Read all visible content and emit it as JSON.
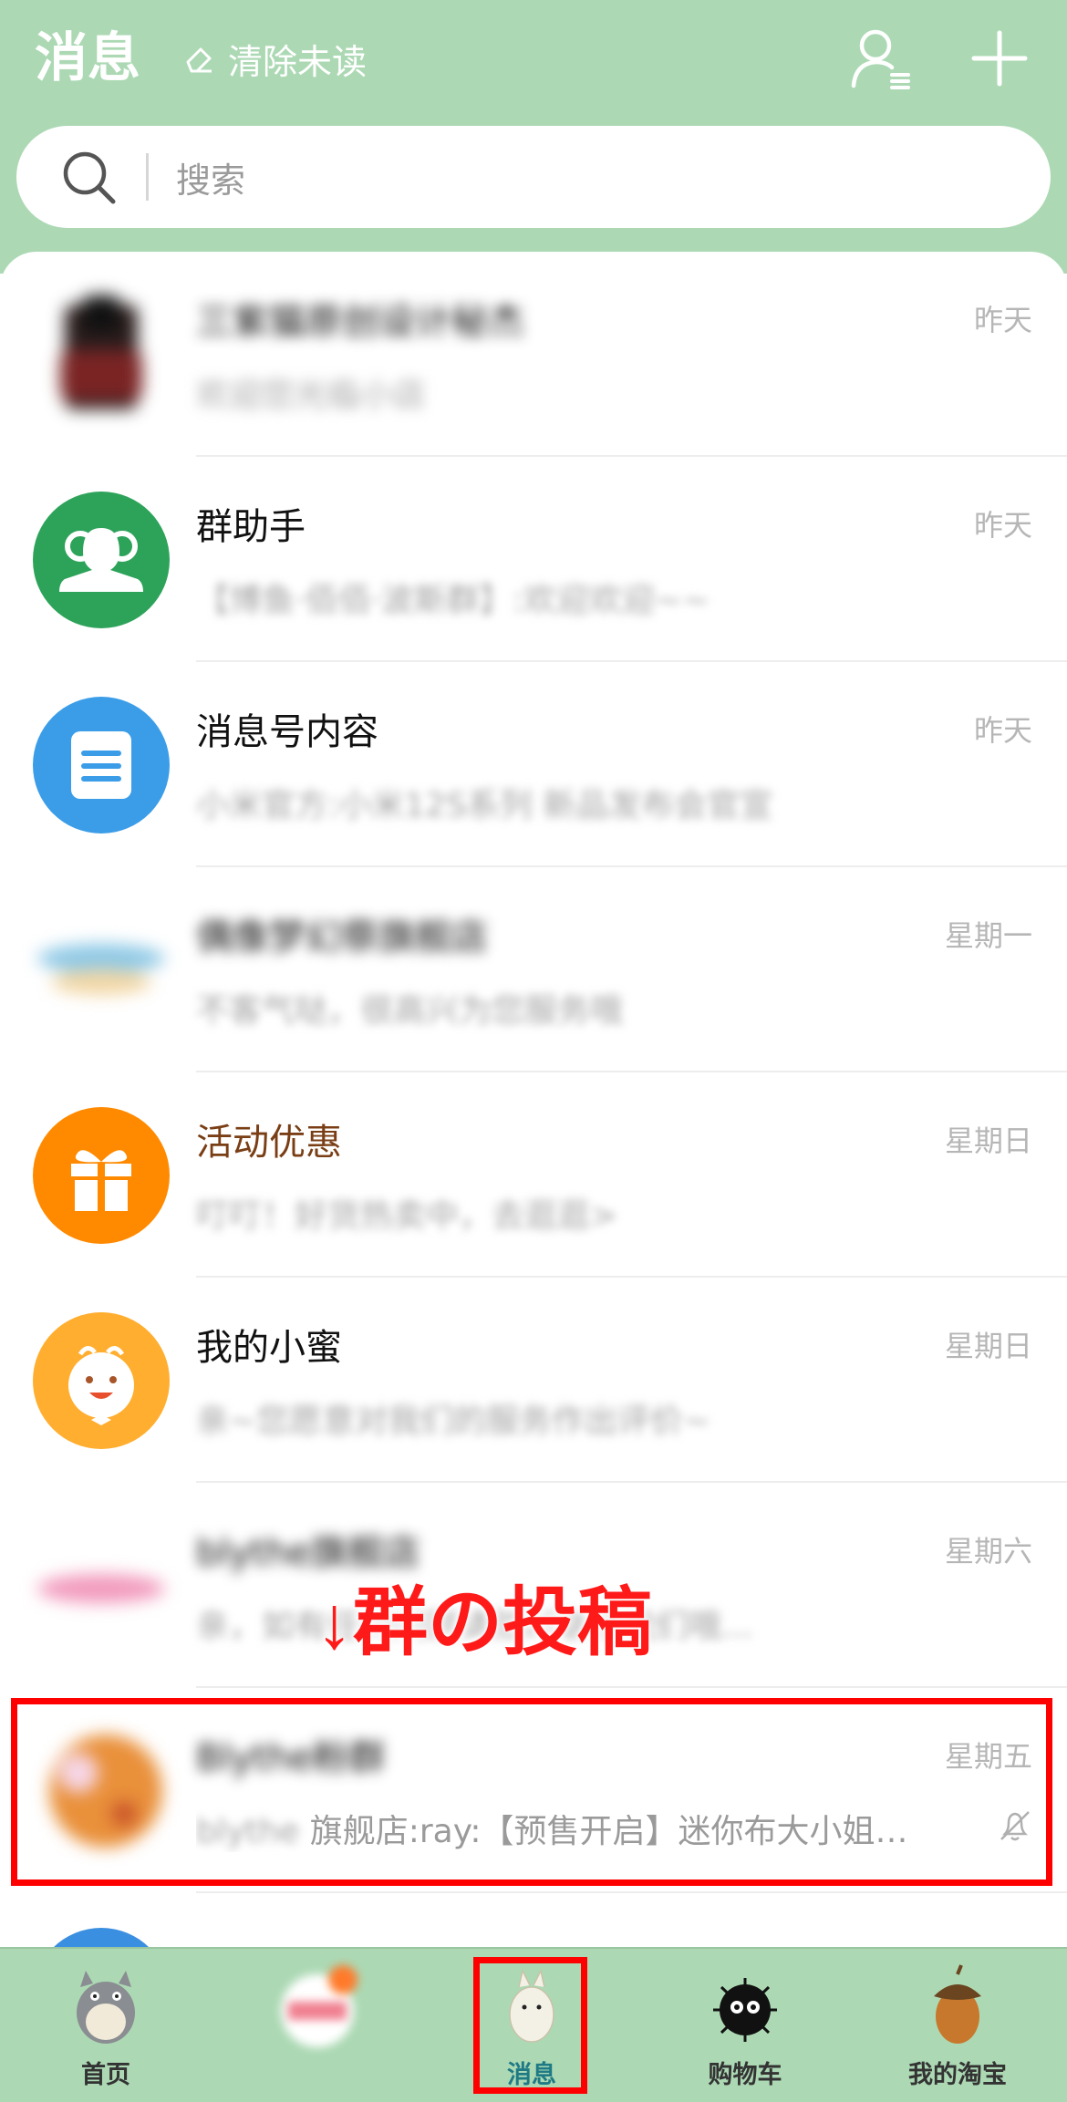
{
  "header": {
    "title": "消息",
    "clear_unread": "清除未读",
    "contacts_icon": "contacts-list-icon",
    "add_icon": "plus-icon"
  },
  "search": {
    "placeholder": "搜索"
  },
  "conversations": [
    {
      "name": "三紫猫原创设计秘杰",
      "preview": "欢迎您光临小店",
      "time": "昨天",
      "blurred": true
    },
    {
      "name": "群助手",
      "preview": "【博鱼·佰佰·波斯群】:欢迎欢迎~~",
      "time": "昨天",
      "blurred": false
    },
    {
      "name": "消息号内容",
      "preview": "小米官方:小米12S系列 新品发布会官宣",
      "time": "昨天",
      "blurred": false
    },
    {
      "name": "偶像梦幻祭旗舰店",
      "preview": "不客气哒，很高兴为您服务哦",
      "time": "星期一",
      "blurred": true
    },
    {
      "name": "活动优惠",
      "preview": "叮叮！好货热卖中，去逛逛>",
      "time": "星期日",
      "blurred": false
    },
    {
      "name": "我的小蜜",
      "preview": "亲~您愿意对我们的服务作出评价~",
      "time": "星期日",
      "blurred": false
    },
    {
      "name": "blythe旗舰店",
      "preview": "亲，如有任何问题请随时联系我们哦...",
      "time": "星期六",
      "blurred": true
    },
    {
      "name": "Blythe粉群",
      "preview_blur": "blythe",
      "preview": "旗舰店:ray:【预售开启】迷你布大小姐…",
      "time": "星期五",
      "blurred": true,
      "muted": true
    }
  ],
  "annotation": {
    "text": "↓群の投稿"
  },
  "tabbar": {
    "tabs": [
      {
        "label": "首页"
      },
      {
        "label": ""
      },
      {
        "label": "消息"
      },
      {
        "label": "购物车"
      },
      {
        "label": "我的淘宝"
      }
    ]
  },
  "colors": {
    "header_bg": "#acd9b4",
    "annotation_red": "#ff1a1a",
    "active_tab": "#1f7a85"
  }
}
